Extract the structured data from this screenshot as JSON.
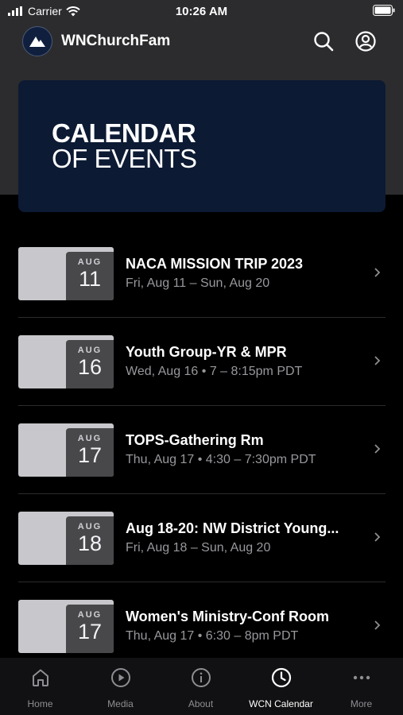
{
  "status_bar": {
    "carrier": "Carrier",
    "time": "10:26 AM"
  },
  "header": {
    "app_name": "WNChurchFam"
  },
  "banner": {
    "line1": "CALENDAR",
    "line2": "OF EVENTS"
  },
  "events": [
    {
      "month": "AUG",
      "day": "11",
      "title": "NACA MISSION TRIP 2023",
      "subtitle": "Fri, Aug 11 – Sun, Aug 20"
    },
    {
      "month": "AUG",
      "day": "16",
      "title": "Youth Group-YR & MPR",
      "subtitle": "Wed, Aug 16 • 7 – 8:15pm PDT"
    },
    {
      "month": "AUG",
      "day": "17",
      "title": "TOPS-Gathering Rm",
      "subtitle": "Thu, Aug 17 • 4:30 – 7:30pm PDT"
    },
    {
      "month": "AUG",
      "day": "18",
      "title": "Aug 18-20:  NW District Young...",
      "subtitle": "Fri, Aug 18 – Sun, Aug 20"
    },
    {
      "month": "AUG",
      "day": "17",
      "title": "Women's Ministry-Conf Room",
      "subtitle": "Thu, Aug 17 • 6:30 – 8pm PDT"
    }
  ],
  "tabs": [
    {
      "label": "Home",
      "icon": "home-icon"
    },
    {
      "label": "Media",
      "icon": "play-icon"
    },
    {
      "label": "About",
      "icon": "info-icon"
    },
    {
      "label": "WCN Calendar",
      "icon": "clock-icon",
      "active": true
    },
    {
      "label": "More",
      "icon": "more-icon"
    }
  ],
  "colors": {
    "background": "#000000",
    "header_bg": "#2c2c2e",
    "banner_bg": "#0c1a33",
    "tab_active": "#ffffff",
    "tab_inactive": "#8e8e93"
  }
}
